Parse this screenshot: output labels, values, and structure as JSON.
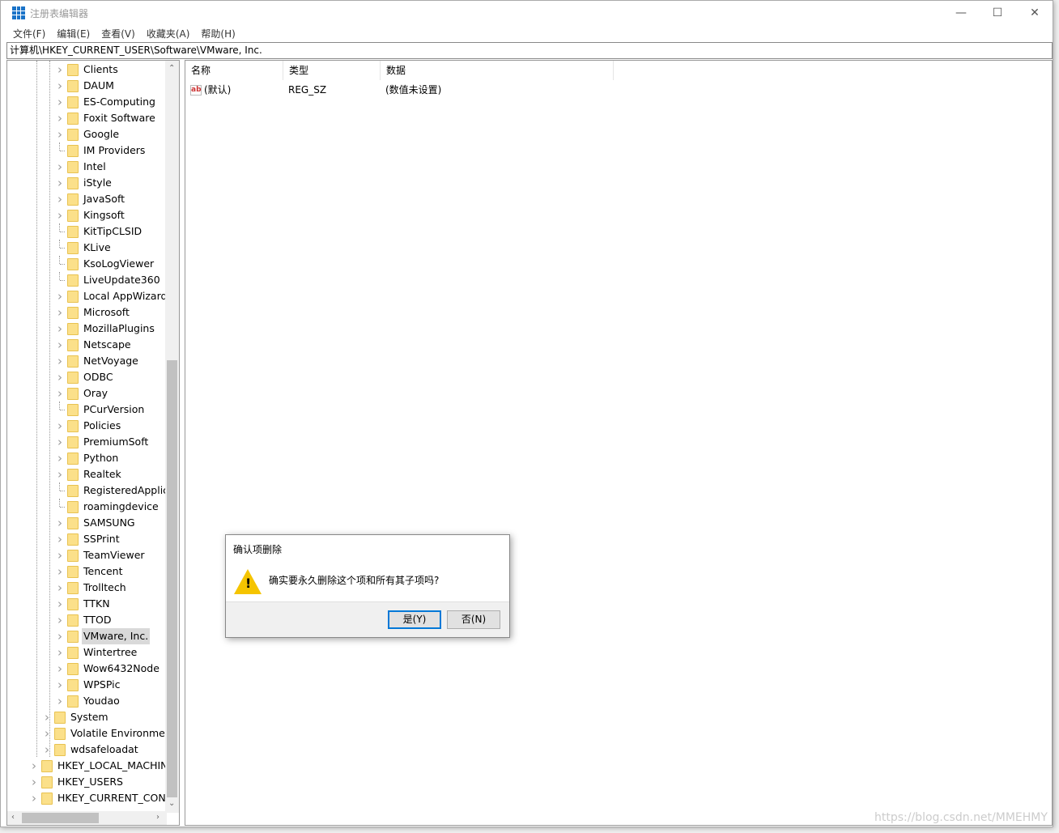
{
  "window": {
    "title": "注册表编辑器",
    "controls": [
      "minimize",
      "maximize",
      "close"
    ]
  },
  "menu": [
    "文件(F)",
    "编辑(E)",
    "查看(V)",
    "收藏夹(A)",
    "帮助(H)"
  ],
  "address": "计算机\\HKEY_CURRENT_USER\\Software\\VMware, Inc.",
  "tree": [
    {
      "label": "Clients",
      "level": 2,
      "expandable": true
    },
    {
      "label": "DAUM",
      "level": 2,
      "expandable": true
    },
    {
      "label": "ES-Computing",
      "level": 2,
      "expandable": true
    },
    {
      "label": "Foxit Software",
      "level": 2,
      "expandable": true
    },
    {
      "label": "Google",
      "level": 2,
      "expandable": true
    },
    {
      "label": "IM Providers",
      "level": 2,
      "expandable": false
    },
    {
      "label": "Intel",
      "level": 2,
      "expandable": true
    },
    {
      "label": "iStyle",
      "level": 2,
      "expandable": true
    },
    {
      "label": "JavaSoft",
      "level": 2,
      "expandable": true
    },
    {
      "label": "Kingsoft",
      "level": 2,
      "expandable": true
    },
    {
      "label": "KitTipCLSID",
      "level": 2,
      "expandable": false
    },
    {
      "label": "KLive",
      "level": 2,
      "expandable": false
    },
    {
      "label": "KsoLogViewer",
      "level": 2,
      "expandable": false
    },
    {
      "label": "LiveUpdate360",
      "level": 2,
      "expandable": false
    },
    {
      "label": "Local AppWizard-Generated Applications",
      "level": 2,
      "expandable": true
    },
    {
      "label": "Microsoft",
      "level": 2,
      "expandable": true
    },
    {
      "label": "MozillaPlugins",
      "level": 2,
      "expandable": true
    },
    {
      "label": "Netscape",
      "level": 2,
      "expandable": true
    },
    {
      "label": "NetVoyage",
      "level": 2,
      "expandable": true
    },
    {
      "label": "ODBC",
      "level": 2,
      "expandable": true
    },
    {
      "label": "Oray",
      "level": 2,
      "expandable": true
    },
    {
      "label": "PCurVersion",
      "level": 2,
      "expandable": false
    },
    {
      "label": "Policies",
      "level": 2,
      "expandable": true
    },
    {
      "label": "PremiumSoft",
      "level": 2,
      "expandable": true
    },
    {
      "label": "Python",
      "level": 2,
      "expandable": true
    },
    {
      "label": "Realtek",
      "level": 2,
      "expandable": true
    },
    {
      "label": "RegisteredApplications",
      "level": 2,
      "expandable": false
    },
    {
      "label": "roamingdevice",
      "level": 2,
      "expandable": false
    },
    {
      "label": "SAMSUNG",
      "level": 2,
      "expandable": true
    },
    {
      "label": "SSPrint",
      "level": 2,
      "expandable": true
    },
    {
      "label": "TeamViewer",
      "level": 2,
      "expandable": true
    },
    {
      "label": "Tencent",
      "level": 2,
      "expandable": true
    },
    {
      "label": "Trolltech",
      "level": 2,
      "expandable": true
    },
    {
      "label": "TTKN",
      "level": 2,
      "expandable": true
    },
    {
      "label": "TTOD",
      "level": 2,
      "expandable": true
    },
    {
      "label": "VMware, Inc.",
      "level": 2,
      "expandable": true,
      "selected": true
    },
    {
      "label": "Wintertree",
      "level": 2,
      "expandable": true
    },
    {
      "label": "Wow6432Node",
      "level": 2,
      "expandable": true
    },
    {
      "label": "WPSPic",
      "level": 2,
      "expandable": true
    },
    {
      "label": "Youdao",
      "level": 2,
      "expandable": true
    },
    {
      "label": "System",
      "level": 1,
      "expandable": true
    },
    {
      "label": "Volatile Environment",
      "level": 1,
      "expandable": true
    },
    {
      "label": "wdsafeloadat",
      "level": 1,
      "expandable": true
    },
    {
      "label": "HKEY_LOCAL_MACHINE",
      "level": 0,
      "expandable": true
    },
    {
      "label": "HKEY_USERS",
      "level": 0,
      "expandable": true
    },
    {
      "label": "HKEY_CURRENT_CONFIG",
      "level": 0,
      "expandable": true
    }
  ],
  "list": {
    "headers": [
      "名称",
      "类型",
      "数据"
    ],
    "rows": [
      {
        "icon": "ab",
        "name": "(默认)",
        "type": "REG_SZ",
        "data": "(数值未设置)"
      }
    ]
  },
  "dialog": {
    "title": "确认项删除",
    "message": "确实要永久删除这个项和所有其子项吗?",
    "icon": "warning-icon",
    "yes": "是(Y)",
    "no": "否(N)"
  },
  "watermark": "https://blog.csdn.net/MMEHMY"
}
